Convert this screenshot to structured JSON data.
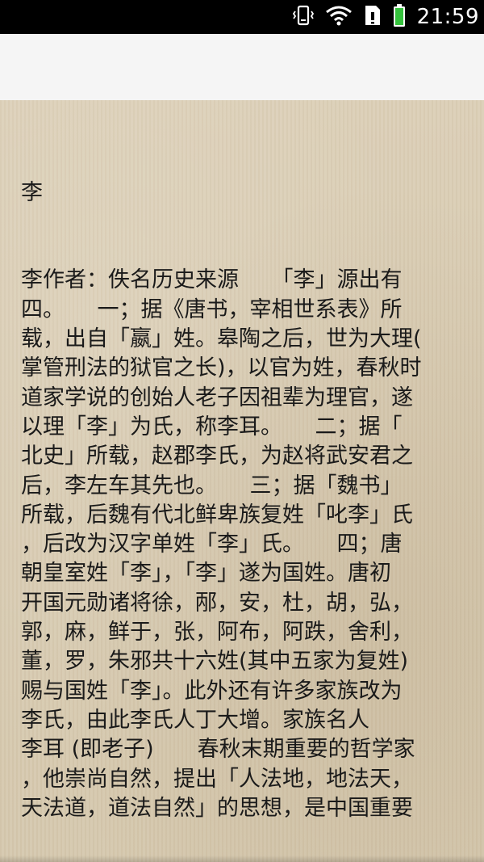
{
  "status_bar": {
    "time": "21:59",
    "icons": [
      "vibrate-icon",
      "wifi-icon",
      "sim-icon",
      "battery-icon"
    ],
    "battery_color": "#34c23c"
  },
  "article": {
    "title": "李",
    "lines": [
      "李作者：佚名历史来源　　「李」源出有",
      "四。　　一；据《唐书，宰相世系表》所",
      "载，出自「嬴」姓。皋陶之后，世为大理(",
      "掌管刑法的狱官之长)，以官为姓，春秋时",
      "道家学说的创始人老子因祖辈为理官，遂",
      "以理「李」为氏，称李耳。　　二；据「",
      "北史」所载，赵郡李氏，为赵将武安君之",
      "后，李左车其先也。　　三；据「魏书」",
      "所载，后魏有代北鲜卑族复姓「叱李」氏",
      "，后改为汉字单姓「李」氏。　　四；唐",
      "朝皇室姓「李」，「李」遂为国姓。唐初",
      "开国元勋诸将徐，邴，安，杜，胡，弘，",
      "郭，麻，鲜于，张，阿布，阿跌，舍利，",
      "董，罗，朱邪共十六姓(其中五家为复姓)",
      "赐与国姓「李」。此外还有许多家族改为",
      "李氏，由此李氏人丁大增。家族名人",
      "李耳 (即老子)　　春秋末期重要的哲学家",
      "，他崇尚自然，提出「人法地，地法天，",
      "天法道，道法自然」的思想，是中国重要"
    ]
  }
}
